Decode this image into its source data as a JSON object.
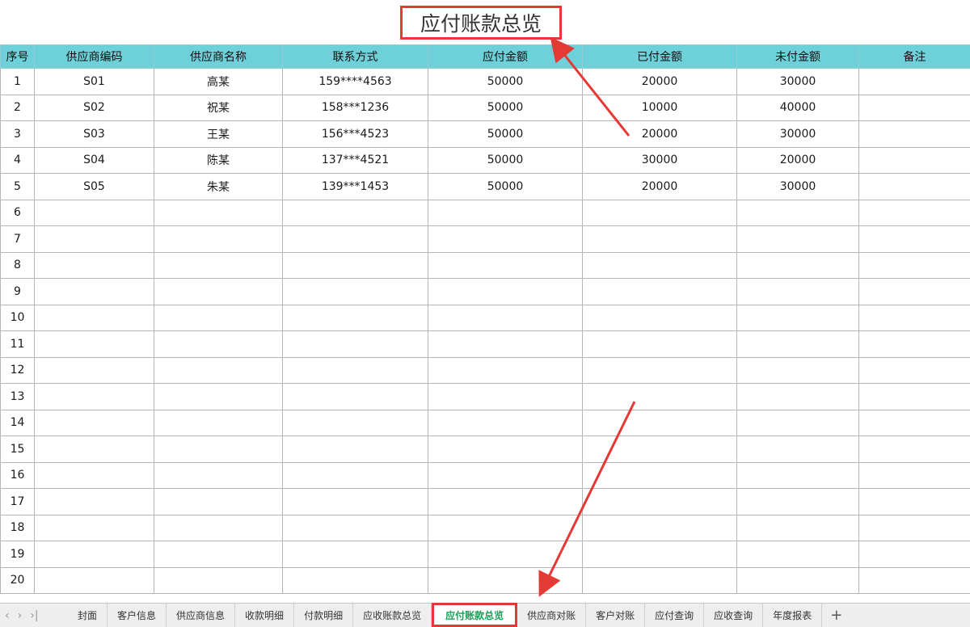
{
  "title": "应付账款总览",
  "columns": [
    "序号",
    "供应商编码",
    "供应商名称",
    "联系方式",
    "应付金额",
    "已付金额",
    "未付金额",
    "备注"
  ],
  "rows": [
    [
      "1",
      "S01",
      "高某",
      "159****4563",
      "50000",
      "20000",
      "30000",
      ""
    ],
    [
      "2",
      "S02",
      "祝某",
      "158***1236",
      "50000",
      "10000",
      "40000",
      ""
    ],
    [
      "3",
      "S03",
      "王某",
      "156***4523",
      "50000",
      "20000",
      "30000",
      ""
    ],
    [
      "4",
      "S04",
      "陈某",
      "137***4521",
      "50000",
      "30000",
      "20000",
      ""
    ],
    [
      "5",
      "S05",
      "朱某",
      "139***1453",
      "50000",
      "20000",
      "30000",
      ""
    ],
    [
      "6",
      "",
      "",
      "",
      "",
      "",
      "",
      ""
    ],
    [
      "7",
      "",
      "",
      "",
      "",
      "",
      "",
      ""
    ],
    [
      "8",
      "",
      "",
      "",
      "",
      "",
      "",
      ""
    ],
    [
      "9",
      "",
      "",
      "",
      "",
      "",
      "",
      ""
    ],
    [
      "10",
      "",
      "",
      "",
      "",
      "",
      "",
      ""
    ],
    [
      "11",
      "",
      "",
      "",
      "",
      "",
      "",
      ""
    ],
    [
      "12",
      "",
      "",
      "",
      "",
      "",
      "",
      ""
    ],
    [
      "13",
      "",
      "",
      "",
      "",
      "",
      "",
      ""
    ],
    [
      "14",
      "",
      "",
      "",
      "",
      "",
      "",
      ""
    ],
    [
      "15",
      "",
      "",
      "",
      "",
      "",
      "",
      ""
    ],
    [
      "16",
      "",
      "",
      "",
      "",
      "",
      "",
      ""
    ],
    [
      "17",
      "",
      "",
      "",
      "",
      "",
      "",
      ""
    ],
    [
      "18",
      "",
      "",
      "",
      "",
      "",
      "",
      ""
    ],
    [
      "19",
      "",
      "",
      "",
      "",
      "",
      "",
      ""
    ],
    [
      "20",
      "",
      "",
      "",
      "",
      "",
      "",
      ""
    ]
  ],
  "sheet_tabs": [
    "封面",
    "客户信息",
    "供应商信息",
    "收款明细",
    "付款明细",
    "应收账款总览",
    "应付账款总览",
    "供应商对账",
    "客户对账",
    "应付查询",
    "应收查询",
    "年度报表"
  ],
  "active_tab": "应付账款总览",
  "nav_icons": [
    "chevron-left-icon",
    "chevron-right-icon",
    "last-sheet-icon"
  ],
  "nav_glyphs": {
    "prev": "‹",
    "next": "›",
    "last": "›|"
  },
  "add_tab_glyph": "+",
  "colors": {
    "header_bg": "#6ed0d8",
    "highlight": "#e53935",
    "active_tab_text": "#18a058"
  }
}
